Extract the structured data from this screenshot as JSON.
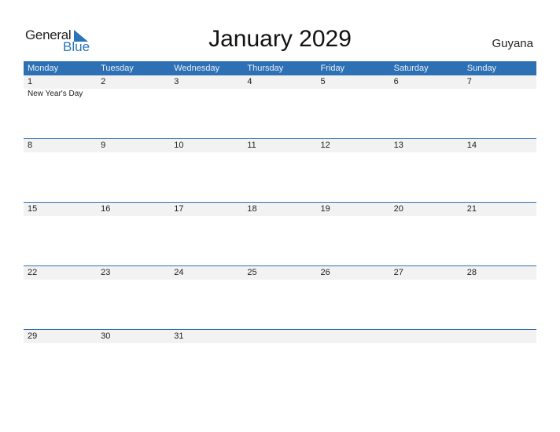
{
  "logo": {
    "general": "General",
    "blue": "Blue"
  },
  "title": "January 2029",
  "country": "Guyana",
  "colors": {
    "accent": "#2e70b4",
    "date_strip": "#f2f2f2"
  },
  "weekdays": [
    "Monday",
    "Tuesday",
    "Wednesday",
    "Thursday",
    "Friday",
    "Saturday",
    "Sunday"
  ],
  "weeks": [
    {
      "days": [
        "1",
        "2",
        "3",
        "4",
        "5",
        "6",
        "7"
      ],
      "events": [
        "New Year's Day",
        "",
        "",
        "",
        "",
        "",
        ""
      ]
    },
    {
      "days": [
        "8",
        "9",
        "10",
        "11",
        "12",
        "13",
        "14"
      ],
      "events": [
        "",
        "",
        "",
        "",
        "",
        "",
        ""
      ]
    },
    {
      "days": [
        "15",
        "16",
        "17",
        "18",
        "19",
        "20",
        "21"
      ],
      "events": [
        "",
        "",
        "",
        "",
        "",
        "",
        ""
      ]
    },
    {
      "days": [
        "22",
        "23",
        "24",
        "25",
        "26",
        "27",
        "28"
      ],
      "events": [
        "",
        "",
        "",
        "",
        "",
        "",
        ""
      ]
    },
    {
      "days": [
        "29",
        "30",
        "31",
        "",
        "",
        "",
        ""
      ],
      "events": [
        "",
        "",
        "",
        "",
        "",
        "",
        ""
      ]
    }
  ]
}
